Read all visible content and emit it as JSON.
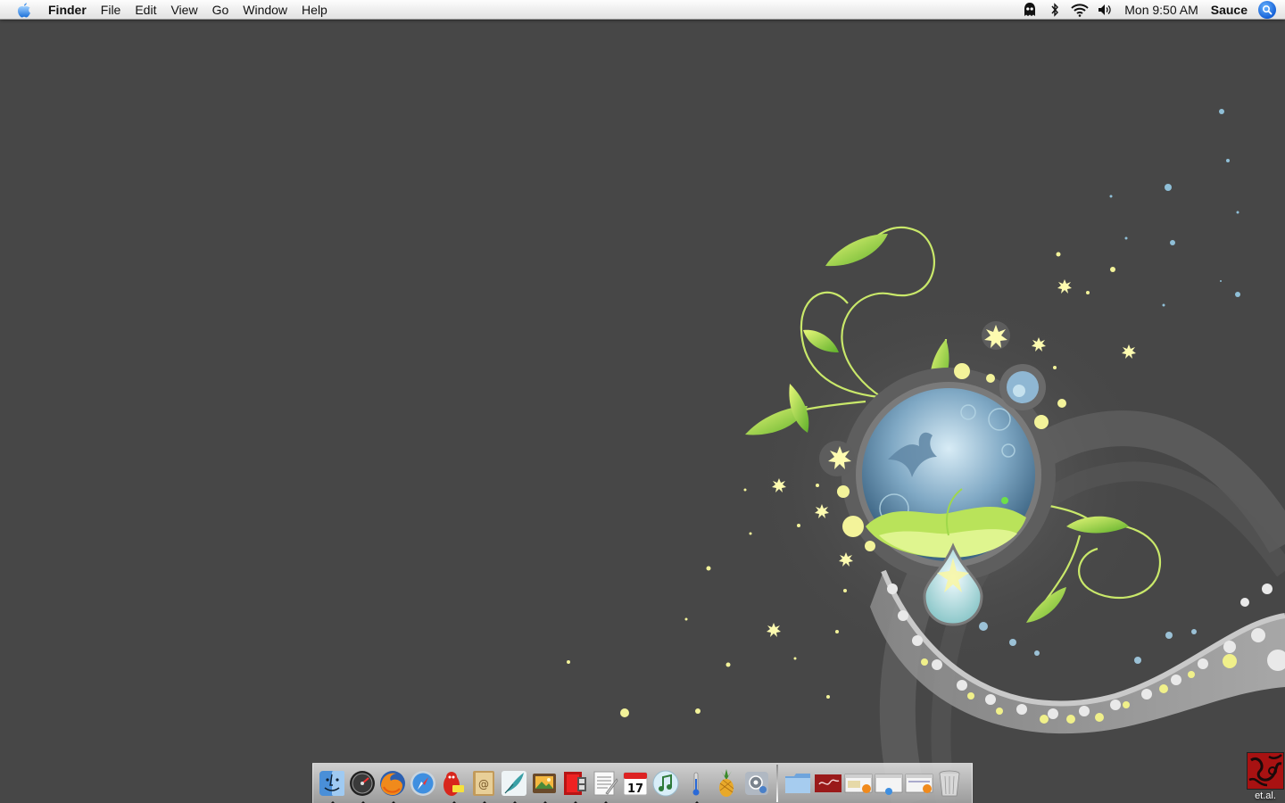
{
  "menubar": {
    "app_name": "Finder",
    "menus": [
      "File",
      "Edit",
      "View",
      "Go",
      "Window",
      "Help"
    ],
    "status_icons": [
      "ghost-icon",
      "bluetooth-icon",
      "wifi-icon",
      "volume-icon"
    ],
    "clock": "Mon 9:50 AM",
    "user": "Sauce"
  },
  "desktop": {
    "icons": [
      {
        "label": "et.al."
      }
    ]
  },
  "dock": {
    "apps": [
      {
        "icon": "finder-icon",
        "running": true
      },
      {
        "icon": "dashboard-icon",
        "running": true
      },
      {
        "icon": "firefox-icon",
        "running": true
      },
      {
        "icon": "safari-icon",
        "running": false
      },
      {
        "icon": "adium-icon",
        "running": true
      },
      {
        "icon": "address-book-icon",
        "running": true
      },
      {
        "icon": "quill-icon",
        "running": true
      },
      {
        "icon": "preview-icon",
        "running": true
      },
      {
        "icon": "photo-booth-icon",
        "running": true
      },
      {
        "icon": "textedit-icon",
        "running": true
      },
      {
        "icon": "ical-icon",
        "running": false
      },
      {
        "icon": "itunes-icon",
        "running": false
      },
      {
        "icon": "thermometer-icon",
        "running": true
      },
      {
        "icon": "pineapple-icon",
        "running": false
      },
      {
        "icon": "system-preferences-icon",
        "running": false
      }
    ],
    "others": [
      {
        "icon": "folder-icon"
      },
      {
        "icon": "document-red-icon"
      },
      {
        "icon": "minimized-window-1-icon"
      },
      {
        "icon": "minimized-window-2-icon"
      },
      {
        "icon": "minimized-window-3-icon"
      },
      {
        "icon": "trash-icon"
      }
    ],
    "calendar_day": "17"
  },
  "colors": {
    "desktop_bg": "#474747",
    "leaf_green": "#a8d94a",
    "orb_blue": "#5f8fb0",
    "dot_yellow": "#f3f39a"
  }
}
